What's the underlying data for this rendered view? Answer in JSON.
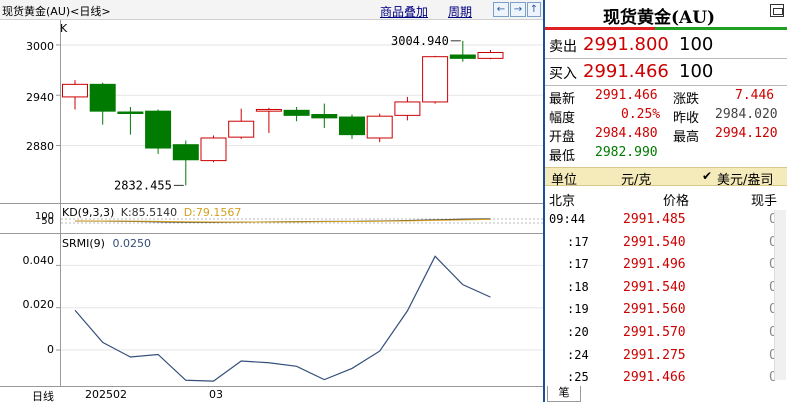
{
  "toolbar": {
    "title": "现货黄金(AU)<日线>",
    "link_overlay": "商品叠加",
    "link_period": "周期",
    "nav_buttons": [
      "←",
      "→",
      "↑",
      "↓"
    ]
  },
  "kpane": {
    "indicator_label": "K",
    "yticks": [
      "3000",
      "2940",
      "2880"
    ],
    "high_annotation": "3004.940",
    "low_annotation": "2832.455"
  },
  "kd": {
    "label": "KD(9,3,3)",
    "k_text": "K:85.5140",
    "d_text": "D:79.1567",
    "ytick_top": "100",
    "ytick_bottom": "50"
  },
  "srmi": {
    "label": "SRMI(9)",
    "value_text": "0.0250",
    "yticks": [
      "0.040",
      "0.020",
      "0"
    ]
  },
  "bottom": {
    "period_label": "日线",
    "date1": "202502",
    "date2": "03"
  },
  "quote": {
    "title": "现货黄金(AU)",
    "sell_label": "卖出",
    "sell_price": "2991.800",
    "sell_vol": "100",
    "buy_label": "买入",
    "buy_price": "2991.466",
    "buy_vol": "100",
    "latest_label": "最新",
    "latest": "2991.466",
    "change_label": "涨跌",
    "change": "7.446",
    "amp_label": "幅度",
    "amp": "0.25%",
    "prev_label": "昨收",
    "prev": "2984.020",
    "open_label": "开盘",
    "open": "2984.480",
    "high_label": "最高",
    "high": "2994.120",
    "low_label": "最低",
    "low": "2982.990",
    "unit_label": "单位",
    "unit_value": "元/克",
    "unit_check": "✔",
    "unit_alt": "美元/盎司",
    "col_time": "北京",
    "col_price": "价格",
    "col_hand": "现手",
    "ticks": [
      {
        "time": "09:44",
        "price": "2991.485",
        "hand": "0"
      },
      {
        "time": ":17",
        "price": "2991.540",
        "hand": "0"
      },
      {
        "time": ":17",
        "price": "2991.496",
        "hand": "0"
      },
      {
        "time": ":18",
        "price": "2991.540",
        "hand": "0"
      },
      {
        "time": ":19",
        "price": "2991.560",
        "hand": "0"
      },
      {
        "time": ":20",
        "price": "2991.570",
        "hand": "0"
      },
      {
        "time": ":24",
        "price": "2991.275",
        "hand": "0"
      },
      {
        "time": ":25",
        "price": "2991.466",
        "hand": "0"
      }
    ],
    "tab_label": "笔"
  },
  "colors": {
    "up": "#cc0000",
    "down": "#007a00",
    "accent_red": "#e02020",
    "accent_green": "#20a020",
    "kd_k": "#333333",
    "kd_d": "#d4a020",
    "srmi_line": "#34507a"
  },
  "chart_data": [
    {
      "type": "candlestick",
      "title": "",
      "ylim": [
        2815,
        3025
      ],
      "yticks": [
        2880,
        2940,
        3000
      ],
      "candles": [
        {
          "open": 2938,
          "close": 2953,
          "high": 2958,
          "low": 2923
        },
        {
          "open": 2953,
          "close": 2921,
          "high": 2955,
          "low": 2905
        },
        {
          "open": 2920,
          "close": 2919,
          "high": 2926,
          "low": 2893
        },
        {
          "open": 2921,
          "close": 2877,
          "high": 2923,
          "low": 2870
        },
        {
          "open": 2881,
          "close": 2863,
          "high": 2886,
          "low": 2832.455
        },
        {
          "open": 2862,
          "close": 2889,
          "high": 2892,
          "low": 2860
        },
        {
          "open": 2890,
          "close": 2909,
          "high": 2924,
          "low": 2888
        },
        {
          "open": 2921,
          "close": 2923,
          "high": 2925,
          "low": 2895
        },
        {
          "open": 2922,
          "close": 2916,
          "high": 2926,
          "low": 2909
        },
        {
          "open": 2917,
          "close": 2913,
          "high": 2930,
          "low": 2901
        },
        {
          "open": 2914,
          "close": 2893,
          "high": 2917,
          "low": 2888
        },
        {
          "open": 2889,
          "close": 2915,
          "high": 2918,
          "low": 2884
        },
        {
          "open": 2916,
          "close": 2932,
          "high": 2938,
          "low": 2910
        },
        {
          "open": 2932,
          "close": 2986,
          "high": 2987,
          "low": 2930
        },
        {
          "open": 2988,
          "close": 2984,
          "high": 3004.94,
          "low": 2980
        },
        {
          "open": 2984,
          "close": 2991,
          "high": 2994,
          "low": 2983
        }
      ]
    },
    {
      "type": "line",
      "title": "",
      "series": [
        {
          "name": "K",
          "values": [
            60,
            58,
            56,
            50,
            45,
            44,
            46,
            50,
            53,
            55,
            56,
            60,
            66,
            74,
            82,
            85.514
          ]
        },
        {
          "name": "D",
          "values": [
            62,
            60,
            58,
            55,
            51,
            48,
            47,
            48,
            50,
            52,
            54,
            57,
            61,
            67,
            74,
            79.1567
          ]
        }
      ],
      "ylim": [
        0,
        120
      ]
    },
    {
      "type": "line",
      "title": "",
      "series": [
        {
          "name": "SRMI(9)",
          "values": [
            0.0188,
            0.0036,
            -0.0033,
            -0.0021,
            -0.0143,
            -0.0147,
            -0.0052,
            -0.006,
            -0.0077,
            -0.014,
            -0.0087,
            -0.0005,
            0.0185,
            0.0443,
            0.0309,
            0.025
          ]
        }
      ],
      "ylim": [
        -0.017,
        0.052
      ],
      "yticks": [
        0,
        0.02,
        0.04
      ]
    }
  ]
}
